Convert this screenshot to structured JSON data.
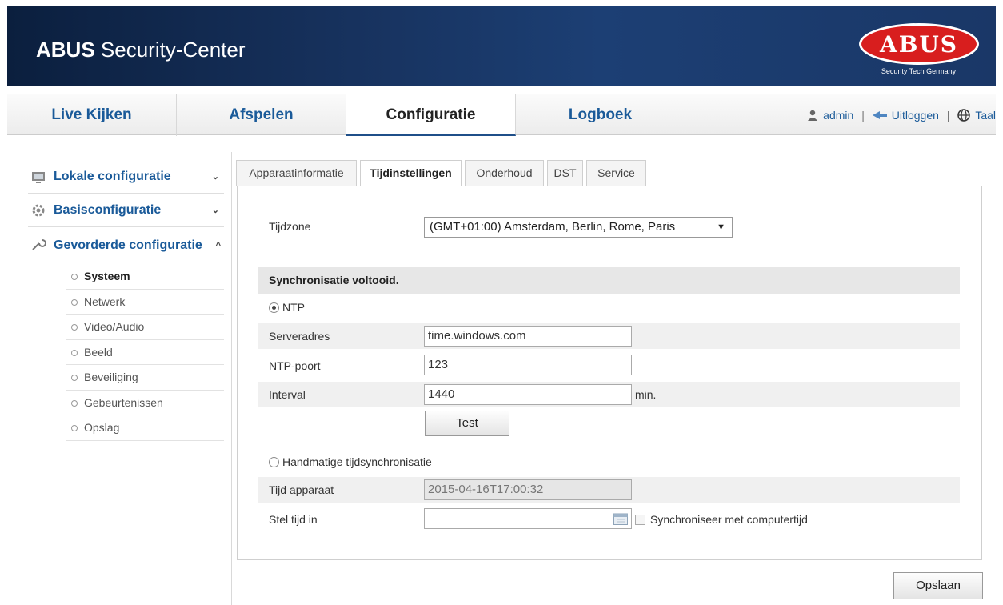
{
  "header": {
    "title_bold": "ABUS",
    "title_rest": " Security-Center",
    "logo_text": "ABUS",
    "logo_tagline": "Security Tech Germany"
  },
  "nav": {
    "tabs": [
      {
        "label": "Live Kijken"
      },
      {
        "label": "Afspelen"
      },
      {
        "label": "Configuratie"
      },
      {
        "label": "Logboek"
      }
    ],
    "user": "admin",
    "logout": "Uitloggen",
    "language": "Taal",
    "separator": "|"
  },
  "sidebar": {
    "sections": [
      {
        "label": "Lokale configuratie",
        "chevron": "⌄"
      },
      {
        "label": "Basisconfiguratie",
        "chevron": "⌄"
      },
      {
        "label": "Gevorderde configuratie",
        "chevron": "^"
      }
    ],
    "items": [
      {
        "label": "Systeem"
      },
      {
        "label": "Netwerk"
      },
      {
        "label": "Video/Audio"
      },
      {
        "label": "Beeld"
      },
      {
        "label": "Beveiliging"
      },
      {
        "label": "Gebeurtenissen"
      },
      {
        "label": "Opslag"
      }
    ]
  },
  "content_tabs": [
    {
      "label": "Apparaatinformatie"
    },
    {
      "label": "Tijdinstellingen"
    },
    {
      "label": "Onderhoud"
    },
    {
      "label": "DST"
    },
    {
      "label": "Service"
    }
  ],
  "form": {
    "timezone_label": "Tijdzone",
    "timezone_value": "(GMT+01:00) Amsterdam, Berlin, Rome, Paris",
    "sync_status": "Synchronisatie voltooid.",
    "ntp_label": "NTP",
    "server_label": "Serveradres",
    "server_value": "time.windows.com",
    "port_label": "NTP-poort",
    "port_value": "123",
    "interval_label": "Interval",
    "interval_value": "1440",
    "interval_unit": "min.",
    "test_button": "Test",
    "manual_label": "Handmatige tijdsynchronisatie",
    "device_time_label": "Tijd apparaat",
    "device_time_value": "2015-04-16T17:00:32",
    "set_time_label": "Stel tijd in",
    "set_time_value": "",
    "sync_computer_label": "Synchroniseer met computertijd",
    "save_button": "Opslaan"
  }
}
